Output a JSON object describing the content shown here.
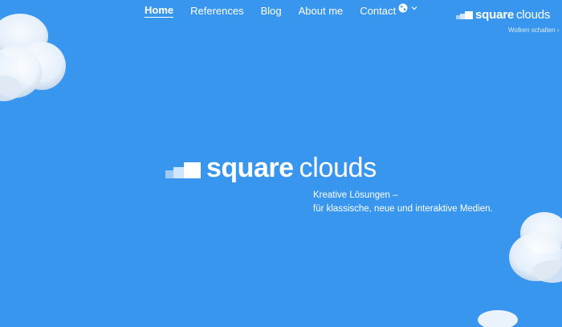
{
  "nav": {
    "items": [
      {
        "label": "Home"
      },
      {
        "label": "References"
      },
      {
        "label": "Blog"
      },
      {
        "label": "About me"
      },
      {
        "label": "Contact"
      }
    ]
  },
  "language": {
    "icon": "globe-icon",
    "chevron": "chevron-down-icon"
  },
  "brand": {
    "word1": "square",
    "word2": "clouds"
  },
  "cloud_toggle": {
    "label": "Wolken schalten ›"
  },
  "hero": {
    "tagline_line1": "Kreative Lösungen –",
    "tagline_line2": "für klassische, neue und interaktive Medien."
  },
  "colors": {
    "background": "#3996ee",
    "text": "#ffffff"
  }
}
